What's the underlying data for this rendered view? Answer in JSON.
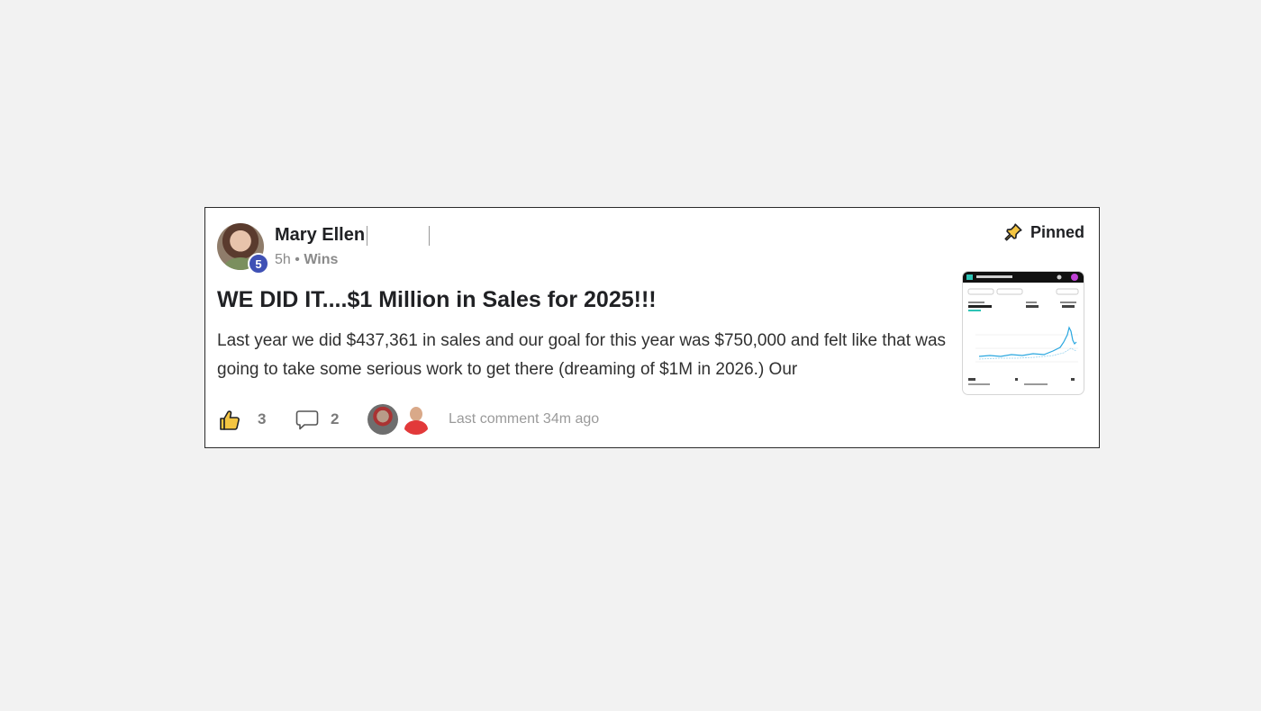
{
  "post": {
    "author_name": "Mary Ellen",
    "author_level": "5",
    "time_ago": "5h",
    "separator": "•",
    "category": "Wins",
    "pinned_label": "Pinned",
    "title": "WE DID IT....$1 Million in Sales for 2025!!!",
    "body": "Last year we did $437,361 in sales and our goal for this year was $750,000 and felt like that was going to take some serious work to get there (dreaming of $1M in 2026.) Our",
    "likes": "3",
    "comments": "2",
    "last_comment": "Last comment 34m ago"
  },
  "icons": {
    "pin": "pushpin-icon",
    "like": "thumbs-up-icon",
    "comment": "speech-bubble-icon"
  },
  "colors": {
    "level_badge": "#3f51b5",
    "thumb_chart_line": "#2aa7e0",
    "thumb_header": "#111111",
    "like_icon_fill": "#f4c542"
  }
}
